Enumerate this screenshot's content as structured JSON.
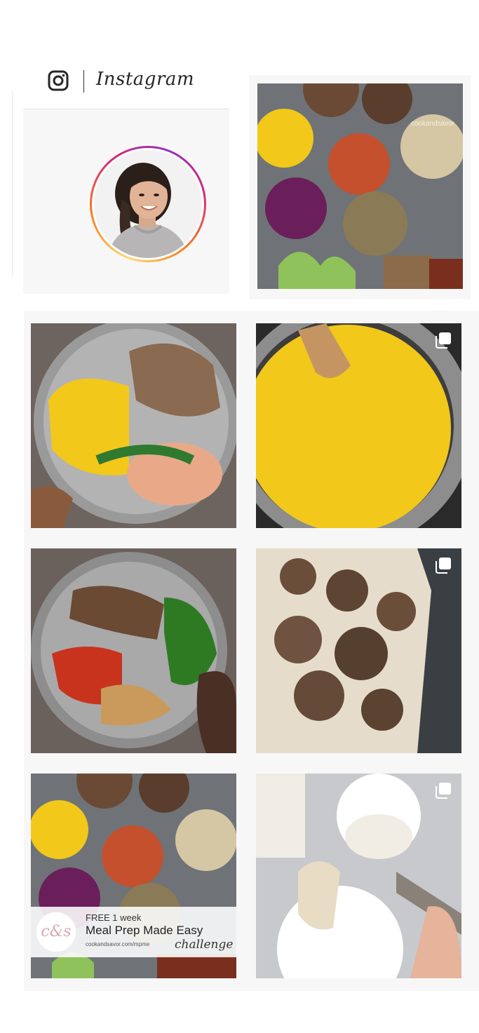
{
  "header": {
    "brand_wordmark": "Instagram",
    "icon": "instagram-camera-icon"
  },
  "profile": {
    "avatar_alt": "Profile photo",
    "ring_colors": [
      "#feda75",
      "#fa7e1e",
      "#d62976",
      "#962fbf"
    ]
  },
  "featured_post": {
    "watermark": "cookandsavor",
    "description": "Meal prep bowls"
  },
  "posts": [
    {
      "description": "Yellow rice, roasted cauliflower and shrimp plate",
      "multi": false
    },
    {
      "description": "Yellow rice in pressure cooker",
      "multi": true
    },
    {
      "description": "Chicken, gnocchi with marinara and broccoli plate",
      "multi": false
    },
    {
      "description": "Roasted pork pieces on sheet pan",
      "multi": true
    },
    {
      "description": "Meal prep bowls",
      "multi": false
    },
    {
      "description": "Muesli on a spoon",
      "multi": true
    }
  ],
  "promo": {
    "logo_text": "c&s",
    "line1": "FREE 1 week",
    "line2": "Meal Prep Made Easy",
    "line3": "cookandsavor.com/mpme",
    "line4": "challenge"
  },
  "colors": {
    "card_bg": "#f7f7f7",
    "rice_yellow": "#f2c81a",
    "plate_gray": "#9a9a9a"
  }
}
